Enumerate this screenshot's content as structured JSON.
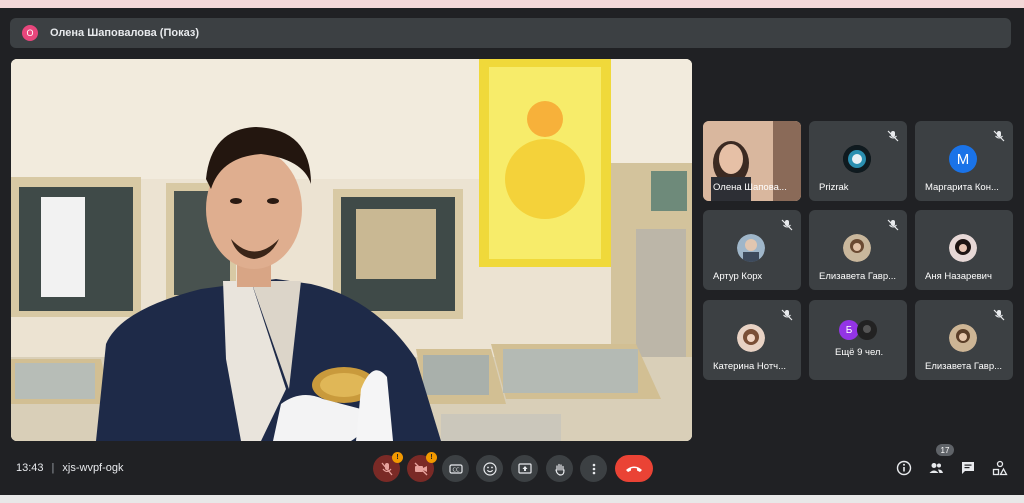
{
  "presenter": {
    "initial": "О",
    "name": "Олена Шаповалова (Показ)"
  },
  "participants": [
    {
      "name": "Олена Шапова...",
      "muted": false,
      "type": "video"
    },
    {
      "name": "Prizrak",
      "muted": true,
      "type": "photo"
    },
    {
      "name": "Маргарита Кон...",
      "muted": true,
      "type": "letter",
      "initial": "М"
    },
    {
      "name": "Артур Корх",
      "muted": true,
      "type": "photo"
    },
    {
      "name": "Елизавета Гавр...",
      "muted": true,
      "type": "photo"
    },
    {
      "name": "Аня Назаревич",
      "muted": false,
      "type": "photo"
    },
    {
      "name": "Катерина Нотч...",
      "muted": true,
      "type": "photo"
    },
    {
      "name": "Ещё 9 чел.",
      "muted": false,
      "type": "more",
      "initial": "Б"
    },
    {
      "name": "Елизавета Гавр...",
      "muted": true,
      "type": "photo"
    }
  ],
  "meeting": {
    "time": "13:43",
    "separator": "|",
    "code": "xjs-wvpf-ogk"
  },
  "controls": {
    "mic_badge": "!",
    "camera_badge": "!",
    "participants_count": "17"
  },
  "colors": {
    "background": "#202124",
    "tile": "#3c4043",
    "danger": "#ea4335",
    "warning": "#f29900",
    "accent": "#1a73e8"
  }
}
